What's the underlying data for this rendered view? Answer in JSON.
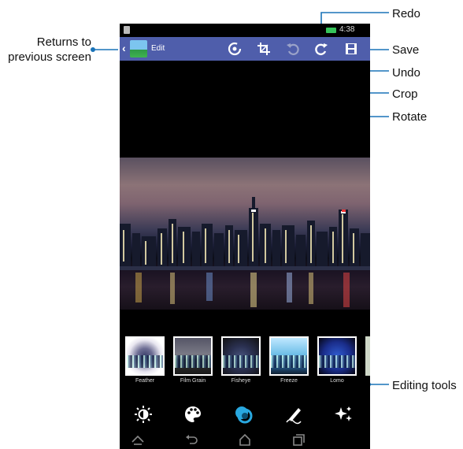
{
  "status_bar": {
    "time": "4:38"
  },
  "action_bar": {
    "title": "Edit"
  },
  "effects": [
    {
      "label": "Feather"
    },
    {
      "label": "Film Grain"
    },
    {
      "label": "Fisheye"
    },
    {
      "label": "Freeze"
    },
    {
      "label": "Lomo"
    }
  ],
  "callouts": {
    "back": "Returns to previous screen",
    "redo": "Redo",
    "save": "Save",
    "undo": "Undo",
    "crop": "Crop",
    "rotate": "Rotate",
    "editing_tools": "Editing tools"
  },
  "colors": {
    "action_bar": "#4f5eab",
    "callout_line": "#1a73b8",
    "selected_tool": "#29a8e0"
  },
  "icons": [
    "back-icon",
    "gallery-app-icon",
    "rotate-icon",
    "crop-icon",
    "undo-icon",
    "redo-icon",
    "save-icon",
    "brightness-icon",
    "palette-icon",
    "effects-icon",
    "pen-icon",
    "sparkle-icon",
    "home-nav-icon",
    "back-nav-icon",
    "recent-apps-icon"
  ]
}
